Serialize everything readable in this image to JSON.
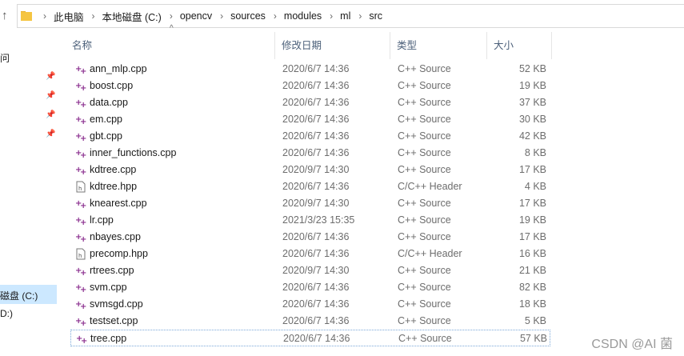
{
  "breadcrumb": [
    "此电脑",
    "本地磁盘 (C:)",
    "opencv",
    "sources",
    "modules",
    "ml",
    "src"
  ],
  "nav": {
    "items": [
      "问",
      "磁盘 (C:)",
      "D:)"
    ]
  },
  "columns": {
    "name": "名称",
    "date": "修改日期",
    "type": "类型",
    "size": "大小"
  },
  "files": [
    {
      "name": "ann_mlp.cpp",
      "date": "2020/6/7 14:36",
      "type": "C++ Source",
      "size": "52 KB",
      "icon": "cpp-file-icon"
    },
    {
      "name": "boost.cpp",
      "date": "2020/6/7 14:36",
      "type": "C++ Source",
      "size": "19 KB",
      "icon": "cpp-file-icon"
    },
    {
      "name": "data.cpp",
      "date": "2020/6/7 14:36",
      "type": "C++ Source",
      "size": "37 KB",
      "icon": "cpp-file-icon"
    },
    {
      "name": "em.cpp",
      "date": "2020/6/7 14:36",
      "type": "C++ Source",
      "size": "30 KB",
      "icon": "cpp-file-icon"
    },
    {
      "name": "gbt.cpp",
      "date": "2020/6/7 14:36",
      "type": "C++ Source",
      "size": "42 KB",
      "icon": "cpp-file-icon"
    },
    {
      "name": "inner_functions.cpp",
      "date": "2020/6/7 14:36",
      "type": "C++ Source",
      "size": "8 KB",
      "icon": "cpp-file-icon"
    },
    {
      "name": "kdtree.cpp",
      "date": "2020/9/7 14:30",
      "type": "C++ Source",
      "size": "17 KB",
      "icon": "cpp-file-icon"
    },
    {
      "name": "kdtree.hpp",
      "date": "2020/6/7 14:36",
      "type": "C/C++ Header",
      "size": "4 KB",
      "icon": "header-file-icon"
    },
    {
      "name": "knearest.cpp",
      "date": "2020/9/7 14:30",
      "type": "C++ Source",
      "size": "17 KB",
      "icon": "cpp-file-icon"
    },
    {
      "name": "lr.cpp",
      "date": "2021/3/23 15:35",
      "type": "C++ Source",
      "size": "19 KB",
      "icon": "cpp-file-icon"
    },
    {
      "name": "nbayes.cpp",
      "date": "2020/6/7 14:36",
      "type": "C++ Source",
      "size": "17 KB",
      "icon": "cpp-file-icon"
    },
    {
      "name": "precomp.hpp",
      "date": "2020/6/7 14:36",
      "type": "C/C++ Header",
      "size": "16 KB",
      "icon": "header-file-icon"
    },
    {
      "name": "rtrees.cpp",
      "date": "2020/9/7 14:30",
      "type": "C++ Source",
      "size": "21 KB",
      "icon": "cpp-file-icon"
    },
    {
      "name": "svm.cpp",
      "date": "2020/6/7 14:36",
      "type": "C++ Source",
      "size": "82 KB",
      "icon": "cpp-file-icon"
    },
    {
      "name": "svmsgd.cpp",
      "date": "2020/6/7 14:36",
      "type": "C++ Source",
      "size": "18 KB",
      "icon": "cpp-file-icon"
    },
    {
      "name": "testset.cpp",
      "date": "2020/6/7 14:36",
      "type": "C++ Source",
      "size": "5 KB",
      "icon": "cpp-file-icon"
    },
    {
      "name": "tree.cpp",
      "date": "2020/6/7 14:36",
      "type": "C++ Source",
      "size": "57 KB",
      "icon": "cpp-file-icon"
    }
  ],
  "watermark": "CSDN @AI 菌",
  "colors": {
    "selection": "#cce8ff",
    "header_text": "#4c607a",
    "cpp_icon": "#8b2f8f",
    "folder": "#f5c542"
  }
}
